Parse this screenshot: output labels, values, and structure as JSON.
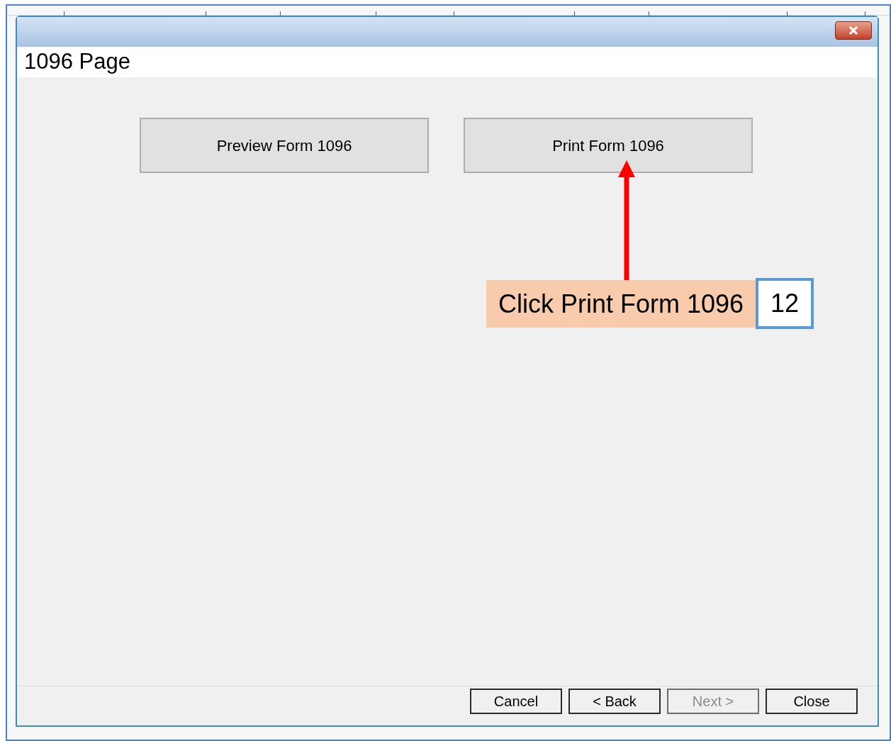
{
  "page": {
    "title": "1096 Page"
  },
  "actions": [
    {
      "label": "Preview Form 1096"
    },
    {
      "label": "Print Form 1096"
    }
  ],
  "callout": {
    "text": "Click Print Form 1096",
    "step": "12"
  },
  "footer_buttons": [
    {
      "label": "Cancel",
      "disabled": false
    },
    {
      "label": "< Back",
      "disabled": false
    },
    {
      "label": "Next >",
      "disabled": true
    },
    {
      "label": "Close",
      "disabled": false
    }
  ]
}
